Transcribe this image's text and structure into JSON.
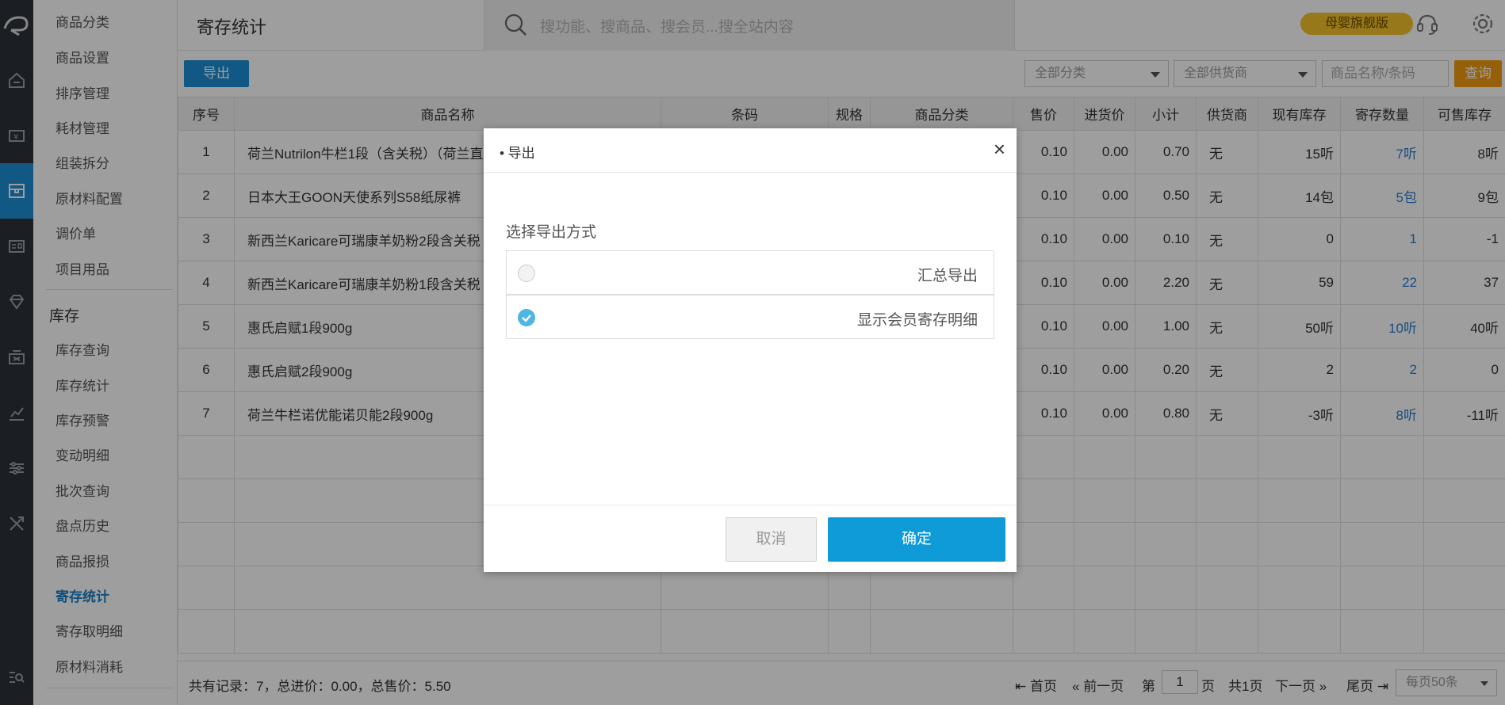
{
  "app": {
    "page_title": "寄存统计",
    "search_placeholder": "搜功能、搜商品、搜会员...搜全站内容",
    "edition_badge": "母婴旗舰版"
  },
  "sidebar": {
    "items_top": [
      "商品分类",
      "商品设置",
      "排序管理",
      "耗材管理",
      "组装拆分",
      "原材料配置",
      "调价单",
      "项目用品"
    ],
    "section_title": "库存",
    "items_stock": [
      "库存查询",
      "库存统计",
      "库存预警",
      "变动明细",
      "批次查询",
      "盘点历史",
      "商品报损",
      "寄存统计",
      "寄存取明细",
      "原材料消耗"
    ],
    "active_item": "寄存统计"
  },
  "toolbar": {
    "export_label": "导出",
    "category_select": "全部分类",
    "supplier_select": "全部供货商",
    "product_input_placeholder": "商品名称/条码",
    "query_label": "查询"
  },
  "table": {
    "headers": [
      "序号",
      "商品名称",
      "条码",
      "规格",
      "商品分类",
      "售价",
      "进货价",
      "小计",
      "供货商",
      "现有库存",
      "寄存数量",
      "可售库存"
    ],
    "rows": [
      {
        "idx": "1",
        "name": "荷兰Nutrilon牛栏1段（含关税）（荷兰直",
        "price": "0.10",
        "cost": "0.00",
        "subtotal": "0.70",
        "supplier": "无",
        "stock": "15听",
        "deposit": "7听",
        "sellable": "8听"
      },
      {
        "idx": "2",
        "name": "日本大王GOON天使系列S58纸尿裤",
        "price": "0.10",
        "cost": "0.00",
        "subtotal": "0.50",
        "supplier": "无",
        "stock": "14包",
        "deposit": "5包",
        "sellable": "9包"
      },
      {
        "idx": "3",
        "name": "新西兰Karicare可瑞康羊奶粉2段含关税",
        "price": "0.10",
        "cost": "0.00",
        "subtotal": "0.10",
        "supplier": "无",
        "stock": "0",
        "deposit": "1",
        "sellable": "-1"
      },
      {
        "idx": "4",
        "name": "新西兰Karicare可瑞康羊奶粉1段含关税",
        "price": "0.10",
        "cost": "0.00",
        "subtotal": "2.20",
        "supplier": "无",
        "stock": "59",
        "deposit": "22",
        "sellable": "37"
      },
      {
        "idx": "5",
        "name": "惠氏启赋1段900g",
        "price": "0.10",
        "cost": "0.00",
        "subtotal": "1.00",
        "supplier": "无",
        "stock": "50听",
        "deposit": "10听",
        "sellable": "40听"
      },
      {
        "idx": "6",
        "name": "惠氏启赋2段900g",
        "price": "0.10",
        "cost": "0.00",
        "subtotal": "0.20",
        "supplier": "无",
        "stock": "2",
        "deposit": "2",
        "sellable": "0"
      },
      {
        "idx": "7",
        "name": "荷兰牛栏诺优能诺贝能2段900g",
        "price": "0.10",
        "cost": "0.00",
        "subtotal": "0.80",
        "supplier": "无",
        "stock": "-3听",
        "deposit": "8听",
        "sellable": "-11听"
      }
    ]
  },
  "footer": {
    "summary": "共有记录：7，总进价：0.00，总售价：5.50",
    "first": "首页",
    "prev": "前一页",
    "page_prefix": "第",
    "page_value": "1",
    "page_suffix": "页",
    "total_pages": "共1页",
    "next": "下一页",
    "last": "尾页",
    "page_size": "每页50条"
  },
  "modal": {
    "title": "• 导出",
    "close": "×",
    "label": "选择导出方式",
    "options": [
      {
        "label": "汇总导出",
        "selected": false
      },
      {
        "label": "显示会员寄存明细",
        "selected": true
      }
    ],
    "cancel": "取消",
    "confirm": "确定"
  },
  "colors": {
    "accent_blue": "#1c8fd6",
    "confirm_blue": "#0f9bd7",
    "query_orange": "#f39c12",
    "badge_yellow": "#f4c22a",
    "rail_dark": "#2d323a",
    "radio_checked": "#4db6e2"
  }
}
